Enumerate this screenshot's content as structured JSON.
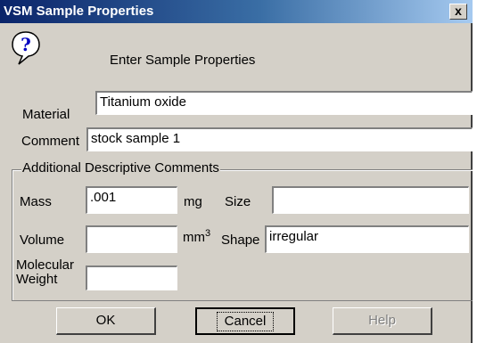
{
  "window": {
    "title": "VSM Sample Properties",
    "close_label": "x"
  },
  "prompt": "Enter Sample Properties",
  "material": {
    "label": "Material",
    "value": "Titanium oxide"
  },
  "comment": {
    "label": "Comment",
    "value": "stock sample 1"
  },
  "group": {
    "title": "Additional Descriptive Comments",
    "mass": {
      "label": "Mass",
      "value": ".001",
      "unit": "mg"
    },
    "size": {
      "label": "Size",
      "value": ""
    },
    "volume": {
      "label": "Volume",
      "value": "",
      "unit": "mm",
      "unit_exponent": "3"
    },
    "shape": {
      "label": "Shape",
      "value": "irregular"
    },
    "molecular_weight": {
      "label_line1": "Molecular",
      "label_line2": "Weight",
      "value": ""
    }
  },
  "buttons": {
    "ok": "OK",
    "cancel": "Cancel",
    "help": "Help"
  },
  "icon": "help-question-icon"
}
